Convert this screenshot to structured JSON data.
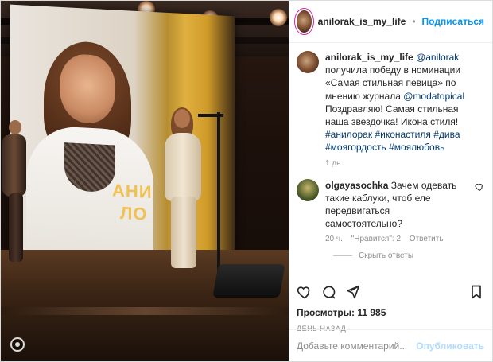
{
  "post": {
    "username": "anilorak_is_my_life",
    "follow_label": "Подписаться",
    "caption": {
      "mention": "@anilorak",
      "line1": "получила победу в номинации «Самая стильная певица» по мнению журнала",
      "mention2": "@modatopical",
      "line2": "Поздравляю!",
      "line3": "Самая стильная наша звездочка!",
      "line4": "Икона стиля!",
      "hashtags": [
        "#анилорак",
        "#иконастиля",
        "#дива",
        "#моягордость",
        "#моялюбовь"
      ],
      "age": "1 дн."
    },
    "comment": {
      "username": "olgayasochka",
      "text": "Зачем одевать такие каблуки, чтоб еле передвигаться самостоятельно?",
      "age": "20 ч.",
      "likes": "\"Нравится\": 2",
      "reply": "Ответить",
      "hide_replies": "Скрыть ответы"
    },
    "stats": {
      "views_label": "Просмотры:",
      "views_value": "11 985",
      "time_label": "ДЕНЬ НАЗАД"
    },
    "input": {
      "placeholder": "Добавьте комментарий...",
      "publish_label": "Опубликовать"
    }
  },
  "media": {
    "screen_text": {
      "ani": "АНИ",
      "lo": "ЛО"
    }
  },
  "icons": {
    "like": "heart-outline-icon",
    "comment": "comment-bubble-icon",
    "share": "paper-plane-icon",
    "save": "bookmark-icon",
    "cursor": "video-cursor-icon",
    "comment_like": "heart-small-icon"
  },
  "colors": {
    "follow": "#0095f6",
    "text": "#262626",
    "muted": "#8e8e8e",
    "link": "#00376b",
    "publish_disabled": "#b3dbff"
  }
}
